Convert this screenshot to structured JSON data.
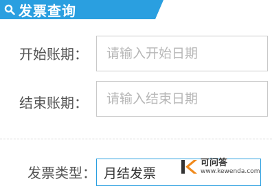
{
  "header": {
    "title": "发票查询",
    "icon": "search-icon"
  },
  "form": {
    "start": {
      "label": "开始账期：",
      "placeholder": "请输入开始日期"
    },
    "end": {
      "label": "结束账期：",
      "placeholder": "请输入结束日期"
    },
    "type": {
      "label": "发票类型：",
      "value": "月结发票"
    }
  },
  "watermark": {
    "brand": "可问答",
    "site": "www.kewenda.com"
  },
  "colors": {
    "accent": "#2a9fe0",
    "watermark_orange": "#f08a1c"
  }
}
